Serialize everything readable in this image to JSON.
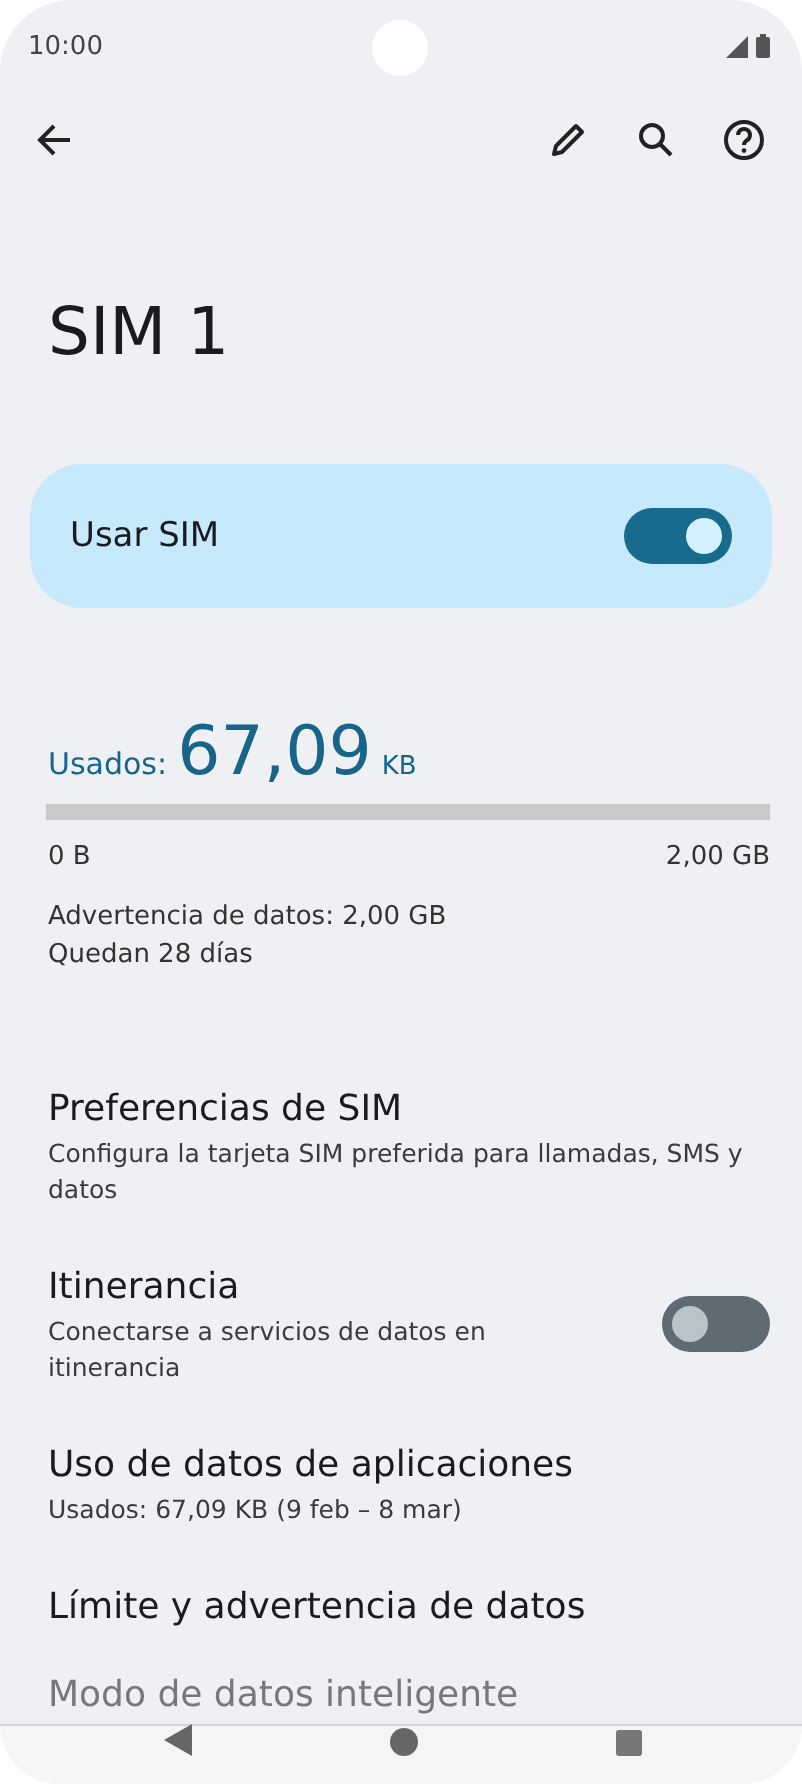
{
  "status_bar": {
    "time": "10:00"
  },
  "title": "SIM 1",
  "main_switch": {
    "label": "Usar SIM",
    "on": true
  },
  "usage": {
    "label": "Usados:",
    "amount": "67,09",
    "unit": "KB",
    "min_label": "0 B",
    "max_label": "2,00 GB",
    "warning": "Advertencia de datos: 2,00 GB",
    "remaining": "Quedan 28 días"
  },
  "settings": [
    {
      "kind": "link",
      "title": "Preferencias de SIM",
      "subtitle": "Configura la tarjeta SIM preferida para llamadas, SMS y datos"
    },
    {
      "kind": "switch",
      "title": "Itinerancia",
      "subtitle": "Conectarse a servicios de datos en itinerancia",
      "on": false
    },
    {
      "kind": "link",
      "title": "Uso de datos de aplicaciones",
      "subtitle": "Usados: 67,09 KB (9 feb – 8 mar)"
    },
    {
      "kind": "link",
      "title": "Límite y advertencia de datos"
    },
    {
      "kind": "faded",
      "title": "Modo de datos inteligente"
    }
  ]
}
